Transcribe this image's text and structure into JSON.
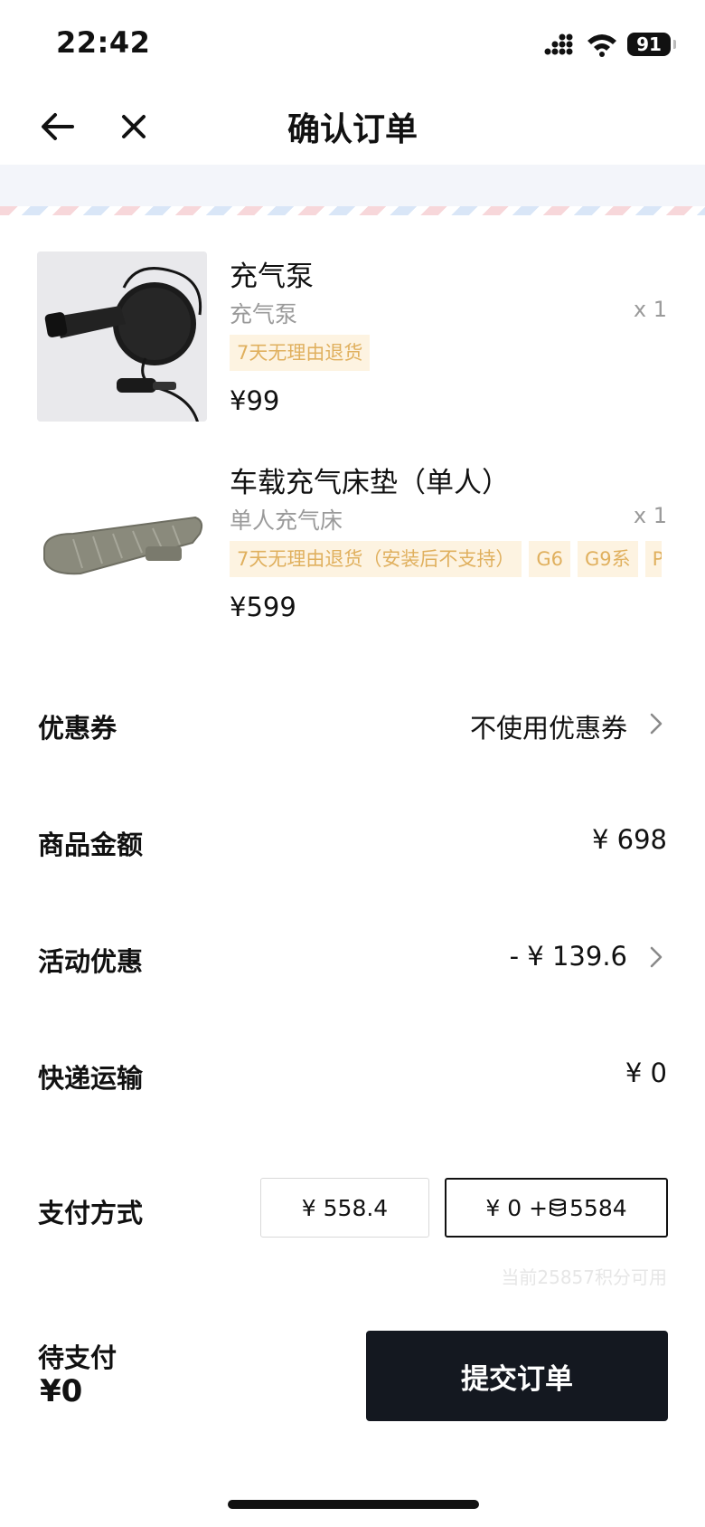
{
  "status": {
    "time": "22:42",
    "battery": "91"
  },
  "nav": {
    "title": "确认订单"
  },
  "products": [
    {
      "name": "充气泵",
      "spec": "充气泵",
      "qty": "x 1",
      "tags": [
        "7天无理由退货"
      ],
      "price": "¥99"
    },
    {
      "name": "车载充气床垫（单人）",
      "spec": "单人充气床",
      "qty": "x 1",
      "tags": [
        "7天无理由退货（安装后不支持）",
        "G6",
        "G9系",
        "P"
      ],
      "price": "¥599"
    }
  ],
  "coupon": {
    "label": "优惠券",
    "value": "不使用优惠券"
  },
  "goods_amount": {
    "label": "商品金额",
    "value": "¥ 698"
  },
  "discount": {
    "label": "活动优惠",
    "value": "- ¥ 139.6"
  },
  "shipping": {
    "label": "快递运输",
    "value": "¥ 0"
  },
  "payment": {
    "label": "支付方式",
    "option_cash": "¥ 558.4",
    "option_points_prefix": "¥ 0 + ",
    "option_points_value": "5584",
    "points_note": "当前25857积分可用"
  },
  "bottom": {
    "pending_label": "待支付",
    "pending_amount": "¥0",
    "submit_label": "提交订单"
  },
  "colors": {
    "primary": "#141820",
    "tag_bg": "#fdf3e1",
    "tag_text": "#e0b05e",
    "muted": "#9a9a9a"
  }
}
